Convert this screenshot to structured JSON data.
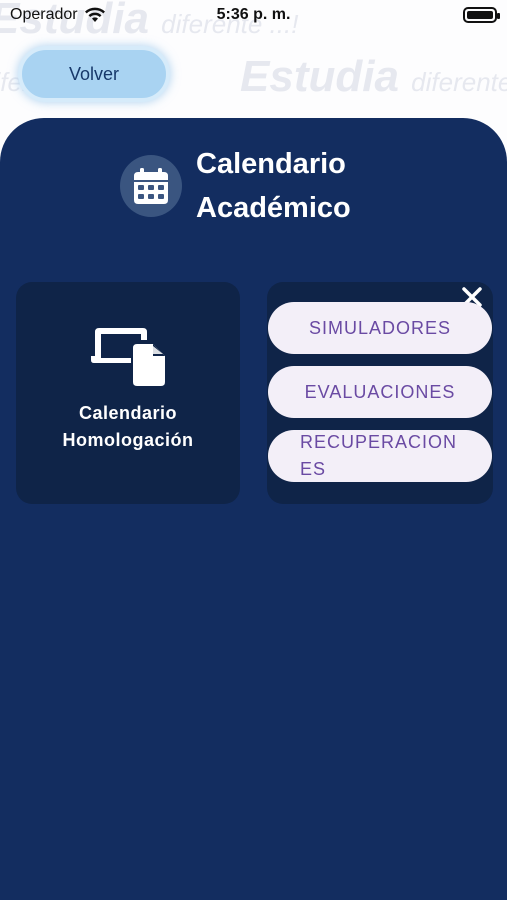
{
  "status_bar": {
    "carrier": "Operador",
    "time": "5:36 p. m.",
    "battery_level": 1.0
  },
  "background": {
    "watermark_word": "Estudia",
    "watermark_tail": "diferente ...!"
  },
  "back_button": {
    "label": "Volver"
  },
  "header": {
    "icon": "calendar-icon",
    "title": "Calendario Académico"
  },
  "cards": {
    "homologacion": {
      "icon": "devices-icon",
      "label": "Calendario Homologación"
    },
    "menu": {
      "close_icon": "close-icon",
      "options": [
        "SIMULADORES",
        "EVALUACIONES",
        "RECUPERACIONES"
      ]
    }
  },
  "colors": {
    "sheet": "#132d60",
    "card": "#0f2448",
    "pill_bg": "#f3eff8",
    "pill_text": "#6a4aa3",
    "back_button": "#a9d3f2"
  }
}
